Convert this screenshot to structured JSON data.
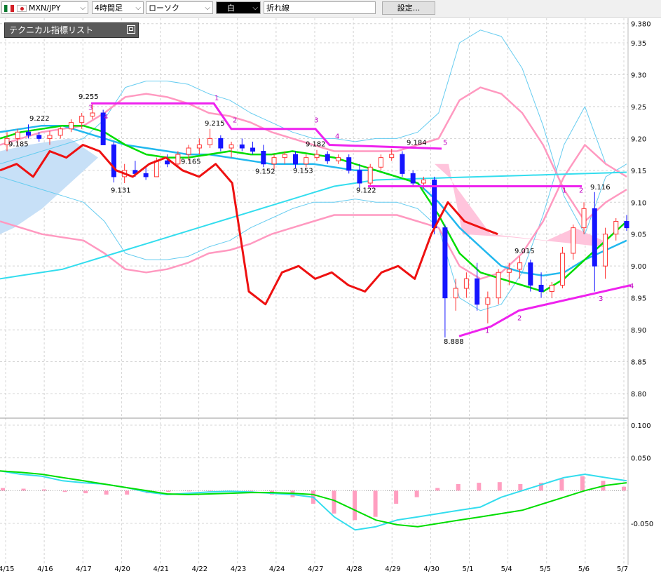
{
  "toolbar": {
    "pair": "MXN/JPY",
    "timeframe": "4時間足",
    "chart_style": "ローソク",
    "color_label": "白",
    "line_type": "折れ線",
    "settings_label": "設定..."
  },
  "panel": {
    "title": "テクニカル指標リスト"
  },
  "colors": {
    "grid": "#d4d4d4",
    "up_candle": "#ff3333",
    "down_candle": "#1515ff",
    "ma_short": "#00dd00",
    "ma_mid": "#22b8ee",
    "ma_long": "#33ddee",
    "bollinger_inner": "#ff99c0",
    "bollinger_outer": "#66ccf0",
    "oscillator": "#ee1111",
    "trendline": "#ee22ee",
    "cloud_bull": "#ffc4dc",
    "cloud_bear": "#c7e0f7"
  },
  "chart_data": {
    "type": "candlestick",
    "main_y_ticks": [
      "9.380",
      "9.35",
      "9.30",
      "9.25",
      "9.20",
      "9.15",
      "9.10",
      "9.05",
      "9.00",
      "8.95",
      "8.90",
      "8.85",
      "8.80"
    ],
    "sub_y_ticks": [
      "0.100",
      "0.050",
      "-0.050"
    ],
    "x_ticks": [
      "4/15",
      "4/16",
      "4/17",
      "4/20",
      "4/21",
      "4/22",
      "4/23",
      "4/24",
      "4/27",
      "4/28",
      "4/29",
      "4/30",
      "5/1",
      "5/4",
      "5/5",
      "5/6",
      "5/7"
    ],
    "price_labels": [
      "9.255",
      "9.222",
      "9.185",
      "9.131",
      "9.215",
      "9.165",
      "9.152",
      "9.153",
      "9.182",
      "9.122",
      "9.184",
      "8.888",
      "9.015",
      "9.116"
    ],
    "wave_labels": [
      "1",
      "2",
      "3",
      "4",
      "5",
      "1",
      "2",
      "3",
      "4",
      "1",
      "2",
      "3",
      "4"
    ],
    "candles": [
      {
        "o": 9.19,
        "h": 9.21,
        "l": 9.18,
        "c": 9.2
      },
      {
        "o": 9.2,
        "h": 9.215,
        "l": 9.19,
        "c": 9.21
      },
      {
        "o": 9.21,
        "h": 9.222,
        "l": 9.2,
        "c": 9.205
      },
      {
        "o": 9.205,
        "h": 9.21,
        "l": 9.195,
        "c": 9.2
      },
      {
        "o": 9.2,
        "h": 9.212,
        "l": 9.19,
        "c": 9.205
      },
      {
        "o": 9.205,
        "h": 9.218,
        "l": 9.2,
        "c": 9.215
      },
      {
        "o": 9.215,
        "h": 9.23,
        "l": 9.21,
        "c": 9.225
      },
      {
        "o": 9.225,
        "h": 9.24,
        "l": 9.215,
        "c": 9.235
      },
      {
        "o": 9.235,
        "h": 9.255,
        "l": 9.23,
        "c": 9.24
      },
      {
        "o": 9.24,
        "h": 9.245,
        "l": 9.2,
        "c": 9.19
      },
      {
        "o": 9.19,
        "h": 9.195,
        "l": 9.131,
        "c": 9.14
      },
      {
        "o": 9.14,
        "h": 9.16,
        "l": 9.13,
        "c": 9.15
      },
      {
        "o": 9.15,
        "h": 9.165,
        "l": 9.14,
        "c": 9.145
      },
      {
        "o": 9.145,
        "h": 9.155,
        "l": 9.135,
        "c": 9.14
      },
      {
        "o": 9.14,
        "h": 9.17,
        "l": 9.14,
        "c": 9.165
      },
      {
        "o": 9.165,
        "h": 9.175,
        "l": 9.155,
        "c": 9.16
      },
      {
        "o": 9.16,
        "h": 9.18,
        "l": 9.155,
        "c": 9.175
      },
      {
        "o": 9.175,
        "h": 9.19,
        "l": 9.165,
        "c": 9.185
      },
      {
        "o": 9.185,
        "h": 9.2,
        "l": 9.175,
        "c": 9.19
      },
      {
        "o": 9.19,
        "h": 9.215,
        "l": 9.185,
        "c": 9.2
      },
      {
        "o": 9.2,
        "h": 9.205,
        "l": 9.18,
        "c": 9.185
      },
      {
        "o": 9.185,
        "h": 9.195,
        "l": 9.17,
        "c": 9.19
      },
      {
        "o": 9.19,
        "h": 9.2,
        "l": 9.18,
        "c": 9.185
      },
      {
        "o": 9.185,
        "h": 9.195,
        "l": 9.175,
        "c": 9.18
      },
      {
        "o": 9.18,
        "h": 9.19,
        "l": 9.155,
        "c": 9.16
      },
      {
        "o": 9.16,
        "h": 9.175,
        "l": 9.152,
        "c": 9.17
      },
      {
        "o": 9.17,
        "h": 9.18,
        "l": 9.16,
        "c": 9.175
      },
      {
        "o": 9.175,
        "h": 9.18,
        "l": 9.153,
        "c": 9.16
      },
      {
        "o": 9.16,
        "h": 9.175,
        "l": 9.155,
        "c": 9.17
      },
      {
        "o": 9.17,
        "h": 9.182,
        "l": 9.165,
        "c": 9.175
      },
      {
        "o": 9.175,
        "h": 9.18,
        "l": 9.16,
        "c": 9.165
      },
      {
        "o": 9.165,
        "h": 9.175,
        "l": 9.16,
        "c": 9.17
      },
      {
        "o": 9.17,
        "h": 9.175,
        "l": 9.145,
        "c": 9.15
      },
      {
        "o": 9.15,
        "h": 9.16,
        "l": 9.122,
        "c": 9.13
      },
      {
        "o": 9.13,
        "h": 9.16,
        "l": 9.125,
        "c": 9.155
      },
      {
        "o": 9.155,
        "h": 9.175,
        "l": 9.15,
        "c": 9.17
      },
      {
        "o": 9.17,
        "h": 9.184,
        "l": 9.165,
        "c": 9.175
      },
      {
        "o": 9.175,
        "h": 9.18,
        "l": 9.14,
        "c": 9.145
      },
      {
        "o": 9.145,
        "h": 9.15,
        "l": 9.125,
        "c": 9.13
      },
      {
        "o": 9.13,
        "h": 9.14,
        "l": 9.12,
        "c": 9.135
      },
      {
        "o": 9.135,
        "h": 9.14,
        "l": 9.05,
        "c": 9.06
      },
      {
        "o": 9.06,
        "h": 9.065,
        "l": 8.888,
        "c": 8.95
      },
      {
        "o": 8.95,
        "h": 8.98,
        "l": 8.93,
        "c": 8.965
      },
      {
        "o": 8.965,
        "h": 8.99,
        "l": 8.95,
        "c": 8.98
      },
      {
        "o": 8.98,
        "h": 9.005,
        "l": 8.93,
        "c": 8.94
      },
      {
        "o": 8.94,
        "h": 8.96,
        "l": 8.91,
        "c": 8.95
      },
      {
        "o": 8.95,
        "h": 8.995,
        "l": 8.94,
        "c": 8.99
      },
      {
        "o": 8.99,
        "h": 9.005,
        "l": 8.97,
        "c": 8.995
      },
      {
        "o": 8.995,
        "h": 9.015,
        "l": 8.98,
        "c": 9.005
      },
      {
        "o": 9.005,
        "h": 9.01,
        "l": 8.96,
        "c": 8.97
      },
      {
        "o": 8.97,
        "h": 8.99,
        "l": 8.95,
        "c": 8.96
      },
      {
        "o": 8.96,
        "h": 8.975,
        "l": 8.95,
        "c": 8.97
      },
      {
        "o": 8.97,
        "h": 9.03,
        "l": 8.965,
        "c": 9.02
      },
      {
        "o": 9.02,
        "h": 9.065,
        "l": 9.01,
        "c": 9.06
      },
      {
        "o": 9.06,
        "h": 9.1,
        "l": 9.05,
        "c": 9.09
      },
      {
        "o": 9.09,
        "h": 9.116,
        "l": 8.96,
        "c": 9.0
      },
      {
        "o": 9.0,
        "h": 9.06,
        "l": 8.98,
        "c": 9.05
      },
      {
        "o": 9.05,
        "h": 9.075,
        "l": 9.04,
        "c": 9.07
      },
      {
        "o": 9.07,
        "h": 9.08,
        "l": 9.055,
        "c": 9.06
      }
    ],
    "ma_short": [
      9.2,
      9.21,
      9.215,
      9.22,
      9.22,
      9.21,
      9.19,
      9.175,
      9.17,
      9.17,
      9.175,
      9.18,
      9.175,
      9.175,
      9.18,
      9.175,
      9.17,
      9.16,
      9.15,
      9.14,
      9.13,
      9.08,
      9.02,
      8.99,
      8.98,
      8.97,
      8.96,
      8.98,
      9.01,
      9.04,
      9.07
    ],
    "ma_mid": [
      9.21,
      9.215,
      9.22,
      9.22,
      9.21,
      9.2,
      9.19,
      9.185,
      9.18,
      9.175,
      9.175,
      9.17,
      9.165,
      9.16,
      9.16,
      9.16,
      9.155,
      9.15,
      9.15,
      9.14,
      9.13,
      9.1,
      9.06,
      9.03,
      9.0,
      8.99,
      8.985,
      8.99,
      9.01,
      9.025,
      9.04
    ],
    "ma_long": [
      8.98,
      8.985,
      8.99,
      8.995,
      9.005,
      9.015,
      9.025,
      9.035,
      9.045,
      9.055,
      9.065,
      9.075,
      9.085,
      9.095,
      9.105,
      9.115,
      9.125,
      9.13,
      9.135,
      9.136,
      9.137,
      9.138,
      9.139,
      9.14,
      9.141,
      9.142,
      9.143,
      9.144,
      9.145,
      9.146,
      9.147
    ],
    "bollinger_inner": [
      9.19,
      9.2,
      9.21,
      9.215,
      9.22,
      9.24,
      9.265,
      9.27,
      9.265,
      9.255,
      9.24,
      9.235,
      9.225,
      9.21,
      9.2,
      9.19,
      9.18,
      9.18,
      9.18,
      9.18,
      9.19,
      9.2,
      9.26,
      9.28,
      9.27,
      9.24,
      9.19,
      9.12,
      9.07,
      9.1,
      9.12
    ],
    "bollinger_outer": [
      9.16,
      9.17,
      9.18,
      9.19,
      9.2,
      9.23,
      9.28,
      9.29,
      9.29,
      9.285,
      9.27,
      9.26,
      9.24,
      9.225,
      9.21,
      9.2,
      9.2,
      9.195,
      9.2,
      9.2,
      9.21,
      9.24,
      9.35,
      9.37,
      9.36,
      9.31,
      9.22,
      9.11,
      9.05,
      9.14,
      9.16
    ],
    "oscillator": [
      9.15,
      9.16,
      9.14,
      9.18,
      9.17,
      9.19,
      9.18,
      9.15,
      9.14,
      9.16,
      9.17,
      9.15,
      9.14,
      9.16,
      9.13,
      8.96,
      8.94,
      8.99,
      9.0,
      8.98,
      8.99,
      8.97,
      8.96,
      8.99,
      9.0,
      8.98,
      9.05,
      9.1,
      9.07,
      9.06,
      9.05
    ],
    "macd_hist": [
      0.004,
      0.003,
      0.002,
      -0.002,
      -0.004,
      -0.006,
      -0.006,
      -0.004,
      -0.002,
      -0.001,
      0.0,
      0.0,
      -0.002,
      -0.006,
      -0.01,
      -0.02,
      -0.035,
      -0.045,
      -0.04,
      -0.02,
      -0.01,
      0.004,
      0.01,
      0.012,
      0.013,
      0.01,
      0.012,
      0.018,
      0.022,
      0.015,
      0.006
    ],
    "macd_line": [
      0.03,
      0.025,
      0.022,
      0.015,
      0.012,
      0.01,
      0.005,
      -0.002,
      -0.006,
      -0.004,
      -0.002,
      -0.001,
      -0.002,
      -0.004,
      -0.006,
      -0.01,
      -0.04,
      -0.06,
      -0.055,
      -0.045,
      -0.04,
      -0.035,
      -0.03,
      -0.025,
      -0.01,
      0.0,
      0.01,
      0.02,
      0.025,
      0.02,
      0.015
    ],
    "signal_line": [
      0.03,
      0.028,
      0.025,
      0.02,
      0.015,
      0.01,
      0.005,
      0.0,
      -0.005,
      -0.006,
      -0.005,
      -0.004,
      -0.003,
      -0.003,
      -0.004,
      -0.006,
      -0.015,
      -0.03,
      -0.045,
      -0.052,
      -0.055,
      -0.05,
      -0.045,
      -0.04,
      -0.035,
      -0.03,
      -0.02,
      -0.01,
      0.0,
      0.008,
      0.012
    ]
  }
}
